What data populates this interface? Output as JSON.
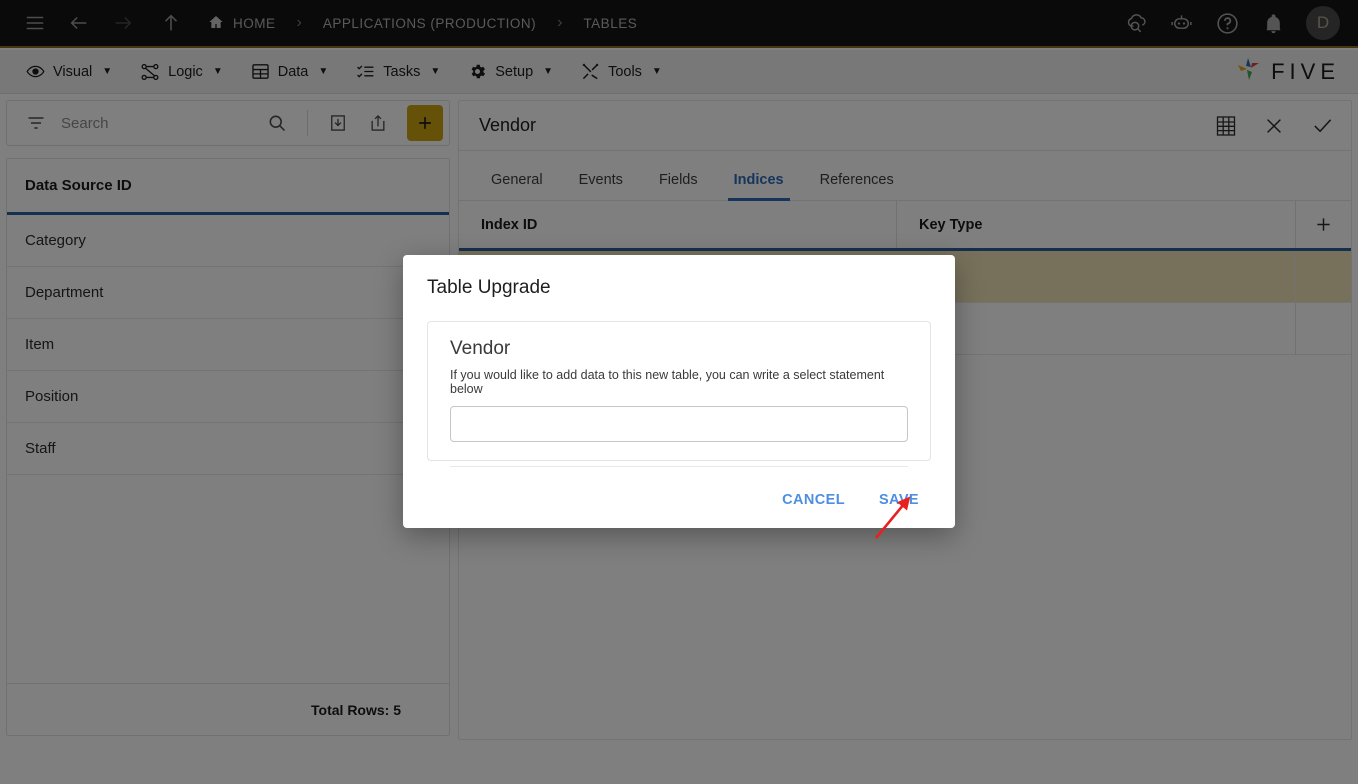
{
  "topbar": {
    "icons": {
      "menu": "hamburger-icon",
      "back": "back-arrow-icon",
      "forward": "forward-arrow-icon",
      "up": "up-arrow-icon",
      "home": "home-icon",
      "cloud": "cloud-check-icon",
      "bot": "chat-bot-icon",
      "help": "help-icon",
      "bell": "notification-bell-icon"
    },
    "breadcrumb": [
      {
        "label": "HOME"
      },
      {
        "label": "APPLICATIONS (PRODUCTION)"
      },
      {
        "label": "TABLES"
      }
    ],
    "separator": "›",
    "avatar_initial": "D"
  },
  "menubar": {
    "items": [
      {
        "label": "Visual",
        "icon": "eye-icon"
      },
      {
        "label": "Logic",
        "icon": "flow-icon"
      },
      {
        "label": "Data",
        "icon": "table-icon"
      },
      {
        "label": "Tasks",
        "icon": "checklist-icon"
      },
      {
        "label": "Setup",
        "icon": "gear-icon"
      },
      {
        "label": "Tools",
        "icon": "tools-icon"
      }
    ],
    "caret": "▼",
    "brand": "FIVE"
  },
  "left_panel": {
    "search": {
      "placeholder": "Search",
      "value": ""
    },
    "toolbar_icons": {
      "filter": "filter-icon",
      "search": "search-icon",
      "import": "import-icon",
      "export": "export-icon",
      "add": "plus-icon"
    },
    "column_header": "Data Source ID",
    "rows": [
      {
        "label": "Category"
      },
      {
        "label": "Department"
      },
      {
        "label": "Item"
      },
      {
        "label": "Position"
      },
      {
        "label": "Staff"
      }
    ],
    "total_rows": "Total Rows: 5"
  },
  "right_panel": {
    "title": "Vendor",
    "actions": {
      "grid": "table-grid-icon",
      "close": "close-icon",
      "confirm": "checkmark-icon"
    },
    "tabs": [
      {
        "label": "General",
        "active": false
      },
      {
        "label": "Events",
        "active": false
      },
      {
        "label": "Fields",
        "active": false
      },
      {
        "label": "Indices",
        "active": true
      },
      {
        "label": "References",
        "active": false
      }
    ],
    "grid": {
      "columns": [
        "Index ID",
        "Key Type"
      ],
      "add_icon": "plus-icon",
      "rows": [
        {
          "index_id": "",
          "key_type": "",
          "selected": true
        },
        {
          "index_id": "",
          "key_type": "",
          "selected": false
        }
      ]
    }
  },
  "dialog": {
    "title": "Table Upgrade",
    "subtitle": "Vendor",
    "description": "If you would like to add data to this new table, you can write a select statement below",
    "input": {
      "value": "",
      "placeholder": ""
    },
    "cancel_label": "CANCEL",
    "save_label": "SAVE"
  },
  "annotation": {
    "arrow": "red-arrow-pointing-to-save",
    "color": "#e8201f"
  },
  "colors": {
    "topbar_bg": "#151515",
    "accent_gold": "#cda211",
    "accent_blue": "#2f6bb5",
    "selected_row": "#efe2b6",
    "dialog_link": "#4f8fe0"
  }
}
